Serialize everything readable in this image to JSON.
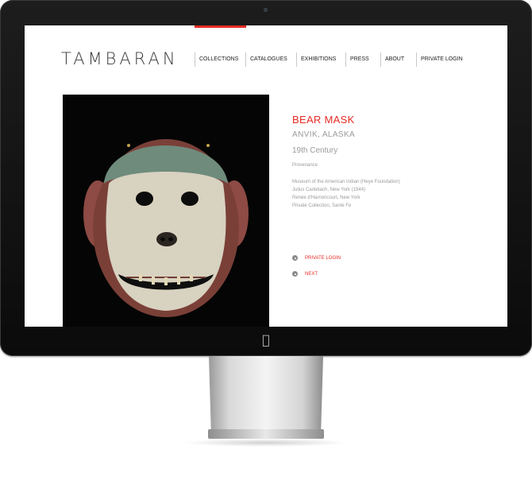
{
  "site": {
    "brand": "TAMBARAN",
    "nav": [
      {
        "label": "COLLECTIONS"
      },
      {
        "label": "CATALOGUES"
      },
      {
        "label": "EXHIBITIONS"
      },
      {
        "label": "PRESS"
      },
      {
        "label": "ABOUT"
      },
      {
        "label": "PRIVATE LOGIN"
      }
    ],
    "accent_color": "#e62b24"
  },
  "artwork": {
    "title": "BEAR MASK",
    "origin": "ANVIK, ALASKA",
    "century": "19th Century",
    "provenance_heading": "Provenance",
    "provenance": [
      "Museum of the American Indian (Heye Foundation)",
      "Julius Carlebach, New York (1944)",
      "Renée d'Harnoncourt, New York",
      "Private Collection, Sante Fe"
    ]
  },
  "actions": {
    "login_label": "PRIVATE LOGIN",
    "next_label": "NEXT"
  },
  "icons": {
    "apple_logo": "apple-logo-icon"
  }
}
